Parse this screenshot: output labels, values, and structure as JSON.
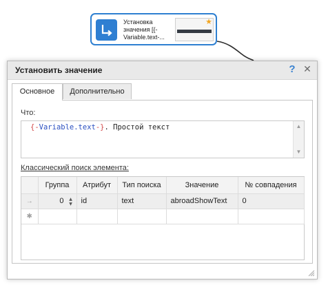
{
  "node": {
    "label": "Установка значения [{-Variable.text-...",
    "icon": "arrow-down-right-icon",
    "star_icon": "star-icon",
    "accent": "#2f7fd2"
  },
  "dialog": {
    "title": "Установить значение",
    "help_label": "?",
    "close_label": "✕",
    "tabs": [
      {
        "label": "Основное",
        "active": true
      },
      {
        "label": "Дополнительно",
        "active": false
      }
    ],
    "what_label": "Что:",
    "value_parts": {
      "open": "{-",
      "variable": "Variable.text",
      "close": "-}",
      "rest": ". Простой текст"
    },
    "search_label": "Классический поиск элемента:",
    "grid": {
      "columns": [
        "",
        "Группа",
        "Атрибут",
        "Тип поиска",
        "Значение",
        "№ совпадения"
      ],
      "rows": [
        {
          "indicator": "→",
          "group": "0",
          "attribute": "id",
          "search_type": "text",
          "value": "abroadShowText",
          "match": "0"
        }
      ],
      "new_row_indicator": "✱"
    }
  }
}
